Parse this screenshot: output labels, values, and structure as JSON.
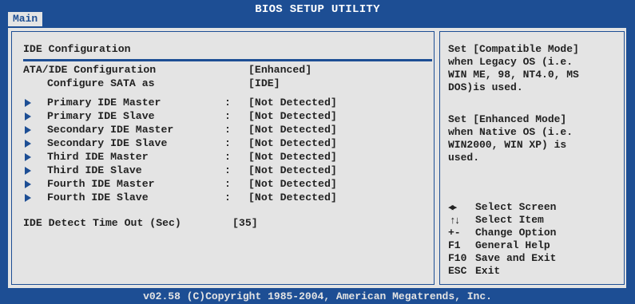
{
  "header": {
    "title": "BIOS SETUP UTILITY",
    "tab": "Main"
  },
  "section": {
    "title": "IDE Configuration"
  },
  "settings": {
    "ata_label": "ATA/IDE Configuration",
    "ata_value": "[Enhanced]",
    "sata_label": "Configure SATA as",
    "sata_value": "[IDE]",
    "devices": [
      {
        "label": "Primary IDE Master",
        "sep": ":",
        "value": "[Not Detected]"
      },
      {
        "label": "Primary IDE Slave",
        "sep": ":",
        "value": "[Not Detected]"
      },
      {
        "label": "Secondary IDE Master",
        "sep": ":",
        "value": "[Not Detected]"
      },
      {
        "label": "Secondary IDE Slave",
        "sep": ":",
        "value": "[Not Detected]"
      },
      {
        "label": "Third IDE Master",
        "sep": ":",
        "value": "[Not Detected]"
      },
      {
        "label": "Third IDE Slave",
        "sep": ":",
        "value": "[Not Detected]"
      },
      {
        "label": "Fourth IDE Master",
        "sep": ":",
        "value": "[Not Detected]"
      },
      {
        "label": "Fourth IDE Slave",
        "sep": ":",
        "value": "[Not Detected]"
      }
    ],
    "timeout_label": "IDE Detect Time Out (Sec)",
    "timeout_value": "[35]"
  },
  "help": {
    "lines": [
      "Set [Compatible Mode]",
      "when Legacy OS (i.e.",
      "WIN ME, 98, NT4.0, MS",
      "DOS)is used.",
      "",
      "Set [Enhanced Mode]",
      "when Native OS (i.e.",
      "WIN2000, WIN XP) is",
      "used."
    ]
  },
  "keys": {
    "select_screen": "Select Screen",
    "select_item": "Select Item",
    "change_option_key": "+-",
    "change_option": "Change Option",
    "general_help_key": "F1",
    "general_help": "General Help",
    "save_exit_key": "F10",
    "save_exit": "Save and Exit",
    "esc_key": "ESC",
    "esc": "Exit"
  },
  "footer": "v02.58 (C)Copyright 1985-2004, American Megatrends, Inc.",
  "colors": {
    "background": "#1d4e94",
    "panel": "#e4e4e4",
    "text": "#222222"
  }
}
